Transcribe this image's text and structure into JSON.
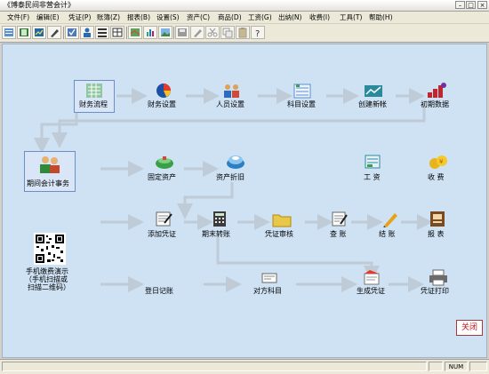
{
  "window": {
    "title": "《博泰民间非营会计》"
  },
  "menu": [
    "文件(F)",
    "编辑(E)",
    "凭证(P)",
    "账簿(Z)",
    "报表(B)",
    "设置(S)",
    "资产(C)",
    "商品(D)",
    "工资(G)",
    "出纳(N)",
    "收费(I)",
    "工具(T)",
    "帮助(H)"
  ],
  "flow": {
    "row1": [
      "财务流程",
      "财务设置",
      "人员设置",
      "科目设置",
      "创建新帐",
      "初期数据"
    ],
    "row2": [
      "期间会计事务",
      "固定资产",
      "资产折旧",
      "工 资",
      "收 费"
    ],
    "row3": [
      "添加凭证",
      "期末转账",
      "凭证审核",
      "查 账",
      "结 账",
      "报 表"
    ],
    "row4": [
      "登日记账",
      "对方科目",
      "生成凭证",
      "凭证打印"
    ],
    "qr_caption": [
      "手机缴费演示",
      "（手机扫描或",
      "扫描二维码）"
    ]
  },
  "buttons": {
    "close": "关闭"
  },
  "status": {
    "num": "NUM"
  },
  "colors": {
    "canvas": "#cfe2f4",
    "arrow": "#bfcbd6",
    "close_text": "#c0141a"
  }
}
